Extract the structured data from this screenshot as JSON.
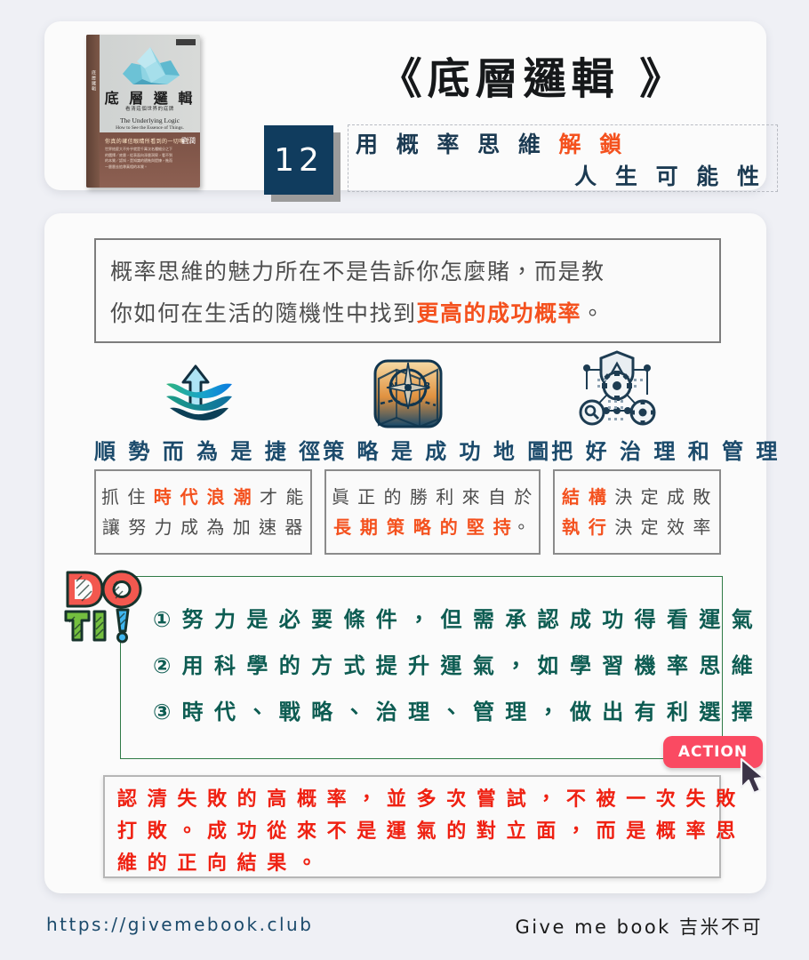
{
  "header": {
    "number_badge": "12",
    "book_title": "《底層邏輯 》",
    "subtitle_line1_plain": "用 概 率 思 維 ",
    "subtitle_line1_highlight": "解 鎖",
    "subtitle_line2": "人 生 可 能 性",
    "book_cover": {
      "spine_text": "底層邏輯",
      "title": "底 層 邏 輯",
      "subtitle": "看清這個世界的底牌",
      "english_line1": "The Underlying Logic",
      "english_line2": "How to See the Essence of Things.",
      "band_question": "你真的確信眼睛所看到的一切嗎？",
      "band_body": "世界這麼大不外乎就是千萬次名種細分之下的選擇／底層，從表面向深層洞察，看不到的本質／認知，是知識的遞進與提煉，進而一層層去追尋真相的本質。",
      "band_body2": "增長是效益「底層邏輯」是的原理／只是思維的名字體系之中最少的一點部分是最實用！",
      "band_body3": "真值得我們所有人，最底層…… 劉潤",
      "author": "劉潤"
    }
  },
  "quote": {
    "line1": "概率思維的魅力所在不是告訴你怎麼賭，而是教",
    "line2_plain_start": "你如何在生活的隨機性中找到",
    "line2_highlight": "更高的成功概率",
    "line2_plain_end": "。"
  },
  "pillars": [
    {
      "icon": "wave-arrow-icon",
      "heading": "順 勢 而 為 是 捷 徑",
      "line1_pre": "抓 住 ",
      "line1_hl": "時 代 浪 潮",
      "line1_post": " 才 能",
      "line2_pre": "讓 努 力 成 為 加 速 器",
      "line2_hl": "",
      "line2_post": ""
    },
    {
      "icon": "map-compass-icon",
      "heading": "策 略 是 成 功 地 圖",
      "line1_pre": "眞 正 的 勝 利 來 自 於",
      "line1_hl": "",
      "line1_post": "",
      "line2_pre": "",
      "line2_hl": "長 期 策 略 的 堅 持",
      "line2_post": "。"
    },
    {
      "icon": "governance-network-icon",
      "heading": "把 好 治 理 和 管 理",
      "line1_pre": "",
      "line1_hl": "結 構",
      "line1_post": " 決 定 成 敗",
      "line2_pre": "",
      "line2_hl": "執 行",
      "line2_post": " 決 定 效 率"
    }
  ],
  "do_it": {
    "letters": [
      "D",
      "O",
      "IT",
      "!"
    ],
    "label": "DO IT!"
  },
  "actions": [
    "① 努 力 是 必 要 條 件 ， 但 需 承 認 成 功 得 看 運 氣",
    "② 用 科 學 的 方 式 提 升 運 氣 ， 如 學 習 機 率 思 維",
    "③ 時 代 、 戰 略 、 治 理 、 管 理 ， 做 出 有 利 選 擇"
  ],
  "action_button": {
    "label": "ACTION"
  },
  "conclusion": {
    "line1": "認 清 失 敗 的 高 概 率 ， 並 多 次 嘗 試 ， 不 被 一 次 失 敗",
    "line2": "打 敗 。 成 功 從 來 不 是 運 氣 的 對 立 面 ， 而 是 概 率 思",
    "line3": "維 的 正 向 結 果 。"
  },
  "footer": {
    "url": "https://givemebook.club",
    "brand": "Give me book 吉米不可"
  },
  "colors": {
    "page_background": "#eff0f5",
    "card_background": "#fbfbfb",
    "accent_orange": "#f4511e",
    "accent_navy": "#103c5e",
    "heading_blue": "#1b4a6b",
    "action_green": "#0d5c52",
    "action_pill": "#fa4a62",
    "conclusion_red": "#ef2112"
  }
}
